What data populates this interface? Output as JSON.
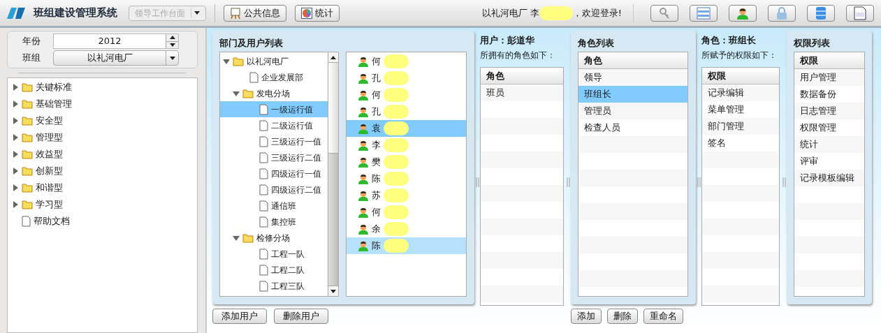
{
  "header": {
    "title": "班组建设管理系统",
    "workspace": {
      "value": "领导工作台面",
      "disabled": true
    },
    "nav_buttons": [
      "公共信息",
      "统计"
    ],
    "welcome_prefix": "以礼河电厂 李",
    "welcome_suffix": "，欢迎登录!"
  },
  "filters": [
    {
      "kind": "spinner",
      "label": "年份",
      "value": "2012"
    },
    {
      "kind": "select",
      "label": "班组",
      "value": "以礼河电厂"
    }
  ],
  "sidebar": {
    "items": [
      {
        "kind": "folder",
        "label": "关键标准",
        "expanded": false
      },
      {
        "kind": "folder",
        "label": "基础管理",
        "expanded": false
      },
      {
        "kind": "folder",
        "label": "安全型",
        "expanded": false
      },
      {
        "kind": "folder",
        "label": "管理型",
        "expanded": false
      },
      {
        "kind": "folder",
        "label": "效益型",
        "expanded": false
      },
      {
        "kind": "folder",
        "label": "创新型",
        "expanded": false
      },
      {
        "kind": "folder",
        "label": "和谐型",
        "expanded": false
      },
      {
        "kind": "folder",
        "label": "学习型",
        "expanded": false
      },
      {
        "kind": "file",
        "label": "帮助文档"
      }
    ]
  },
  "dept_panel": {
    "title": "部门及用户列表",
    "tree": [
      {
        "kind": "folder",
        "label": "以礼河电厂",
        "expanded": true,
        "selected": false,
        "children": [
          {
            "kind": "file",
            "label": "企业发展部",
            "selected": false
          },
          {
            "kind": "folder",
            "label": "发电分场",
            "expanded": true,
            "selected": false,
            "children": [
              {
                "kind": "file",
                "label": "一级运行值",
                "selected": true
              },
              {
                "kind": "file",
                "label": "二级运行值",
                "selected": false
              },
              {
                "kind": "file",
                "label": "三级运行一值",
                "selected": false
              },
              {
                "kind": "file",
                "label": "三级运行二值",
                "selected": false
              },
              {
                "kind": "file",
                "label": "四级运行一值",
                "selected": false
              },
              {
                "kind": "file",
                "label": "四级运行二值",
                "selected": false
              },
              {
                "kind": "file",
                "label": "通信班",
                "selected": false
              },
              {
                "kind": "file",
                "label": "集控班",
                "selected": false
              }
            ]
          },
          {
            "kind": "folder",
            "label": "检修分场",
            "expanded": true,
            "selected": false,
            "children": [
              {
                "kind": "file",
                "label": "工程一队",
                "selected": false
              },
              {
                "kind": "file",
                "label": "工程二队",
                "selected": false
              },
              {
                "kind": "file",
                "label": "工程三队",
                "selected": false
              }
            ]
          }
        ]
      }
    ],
    "users": [
      {
        "name": "何",
        "selected": false,
        "hovered": false
      },
      {
        "name": "孔",
        "selected": false,
        "hovered": false
      },
      {
        "name": "何",
        "selected": false,
        "hovered": false
      },
      {
        "name": "孔",
        "selected": false,
        "hovered": false
      },
      {
        "name": "袁",
        "selected": true,
        "hovered": false
      },
      {
        "name": "李",
        "selected": false,
        "hovered": false
      },
      {
        "name": "樊",
        "selected": false,
        "hovered": false
      },
      {
        "name": "陈",
        "selected": false,
        "hovered": false
      },
      {
        "name": "苏",
        "selected": false,
        "hovered": false
      },
      {
        "name": "何",
        "selected": false,
        "hovered": false
      },
      {
        "name": "余",
        "selected": false,
        "hovered": false
      },
      {
        "name": "陈",
        "selected": false,
        "hovered": true
      }
    ],
    "buttons": [
      "添加用户",
      "删除用户"
    ]
  },
  "user_roles": {
    "title": "用户：彭道华",
    "subtitle": "所拥有的角色如下：",
    "column": "角色",
    "rows": [
      {
        "label": "班员",
        "selected": false
      }
    ]
  },
  "role_list": {
    "title": "角色列表",
    "column": "角色",
    "rows": [
      {
        "label": "领导",
        "selected": false
      },
      {
        "label": "班组长",
        "selected": true
      },
      {
        "label": "管理员",
        "selected": false
      },
      {
        "label": "检查人员",
        "selected": false
      }
    ],
    "buttons": [
      "添加",
      "删除",
      "重命名"
    ]
  },
  "role_perms": {
    "title": "角色：班组长",
    "subtitle": "所赋予的权限如下：",
    "column": "权限",
    "rows": [
      {
        "label": "记录编辑",
        "selected": false
      },
      {
        "label": "菜单管理",
        "selected": false
      },
      {
        "label": "部门管理",
        "selected": false
      },
      {
        "label": "签名",
        "selected": false
      }
    ]
  },
  "perm_list": {
    "title": "权限列表",
    "column": "权限",
    "rows": [
      {
        "label": "用户管理",
        "selected": false
      },
      {
        "label": "数据备份",
        "selected": false
      },
      {
        "label": "日志管理",
        "selected": false
      },
      {
        "label": "权限管理",
        "selected": false
      },
      {
        "label": "统计",
        "selected": false
      },
      {
        "label": "评审",
        "selected": false
      },
      {
        "label": "记录模板编辑",
        "selected": false
      }
    ]
  }
}
